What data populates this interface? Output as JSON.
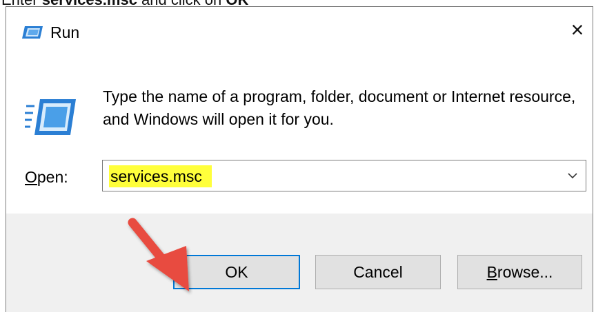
{
  "caption": {
    "prefix": "Enter ",
    "command": "services.msc",
    "middle": " and click on ",
    "action": "OK"
  },
  "dialog": {
    "title": "Run",
    "close_glyph": "×",
    "description": "Type the name of a program, folder, document or Internet resource, and Windows will open it for you.",
    "open_label_accel": "O",
    "open_label_rest": "pen:",
    "open_value": "services.msc",
    "buttons": {
      "ok": "OK",
      "cancel": "Cancel",
      "browse_accel": "B",
      "browse_rest": "rowse..."
    }
  },
  "icons": {
    "title": "run-icon",
    "main": "run-icon",
    "dropdown": "chevron-down-icon",
    "close": "close-icon",
    "annotation": "red-arrow-icon"
  },
  "colors": {
    "highlight": "#ffff3b",
    "focus_border": "#0078d7",
    "arrow": "#e84b3f",
    "footer_bg": "#f0f0f0"
  }
}
